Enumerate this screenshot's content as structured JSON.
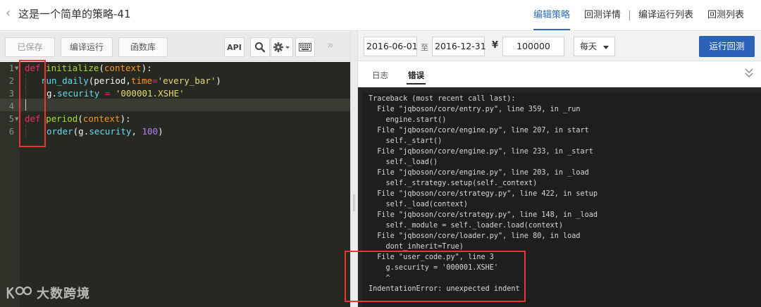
{
  "header": {
    "title": "这是一个简单的策略-41",
    "tabs": [
      {
        "label": "编辑策略",
        "active": true
      },
      {
        "label": "回测详情",
        "active": false
      },
      {
        "label": "编译运行列表",
        "active": false
      },
      {
        "label": "回测列表",
        "active": false
      }
    ]
  },
  "toolbar": {
    "saved_label": "已保存",
    "compile_label": "编译运行",
    "functions_label": "函数库",
    "api_label": "API",
    "icons": [
      "search-icon",
      "gear-icon",
      "keyboard-icon",
      "collapse-left-icon"
    ]
  },
  "editor": {
    "line_numbers": [
      "1",
      "2",
      "3",
      "4",
      "5",
      "6"
    ],
    "lines": {
      "l1": {
        "kw": "def",
        "fn": "initialize",
        "open": "(",
        "param": "context",
        "close": "):"
      },
      "l2": {
        "call": "run_daily",
        "open": "(",
        "arg1": "period",
        "comma": ",",
        "kwarg": "time",
        "eq": "=",
        "str": "'every_bar'",
        "close": ")"
      },
      "l3": {
        "obj": "g.",
        "attr": "security",
        "eq": " = ",
        "str": "'000001.XSHE'"
      },
      "l5": {
        "kw": "def",
        "fn": "period",
        "open": "(",
        "param": "context",
        "close": "):"
      },
      "l6": {
        "call": "order",
        "open": "(",
        "obj": "g.",
        "attr": "security",
        "comma": ", ",
        "num": "100",
        "close": ")"
      }
    }
  },
  "backtest": {
    "start_date": "2016-06-01",
    "to_label": "至",
    "end_date": "2016-12-31",
    "currency_symbol": "¥",
    "capital": "100000",
    "frequency": "每天",
    "run_label": "运行回测"
  },
  "log_tabs": [
    {
      "label": "日志",
      "active": false
    },
    {
      "label": "错误",
      "active": true
    }
  ],
  "console": {
    "lines": [
      "Traceback (most recent call last):",
      "  File \"jqboson/core/entry.py\", line 359, in _run",
      "    engine.start()",
      "  File \"jqboson/core/engine.py\", line 207, in start",
      "    self._start()",
      "  File \"jqboson/core/engine.py\", line 233, in _start",
      "    self._load()",
      "  File \"jqboson/core/engine.py\", line 203, in _load",
      "    self._strategy.setup(self._context)",
      "  File \"jqboson/core/strategy.py\", line 422, in setup",
      "    self._load(context)",
      "  File \"jqboson/core/strategy.py\", line 148, in _load",
      "    self._module = self._loader.load(context)",
      "  File \"jqboson/core/loader.py\", line 80, in load",
      "    dont_inherit=True)",
      "  File \"user_code.py\", line 3",
      "    g.security = '000001.XSHE'",
      "    ^",
      "IndentationError: unexpected indent"
    ]
  },
  "watermark": {
    "text": "大数跨境",
    "logo": "kdd-logo-icon"
  },
  "colors": {
    "accent": "#2f6db7",
    "run_button": "#2a62b8",
    "annotation": "#e33333",
    "editor_bg": "#272822"
  }
}
